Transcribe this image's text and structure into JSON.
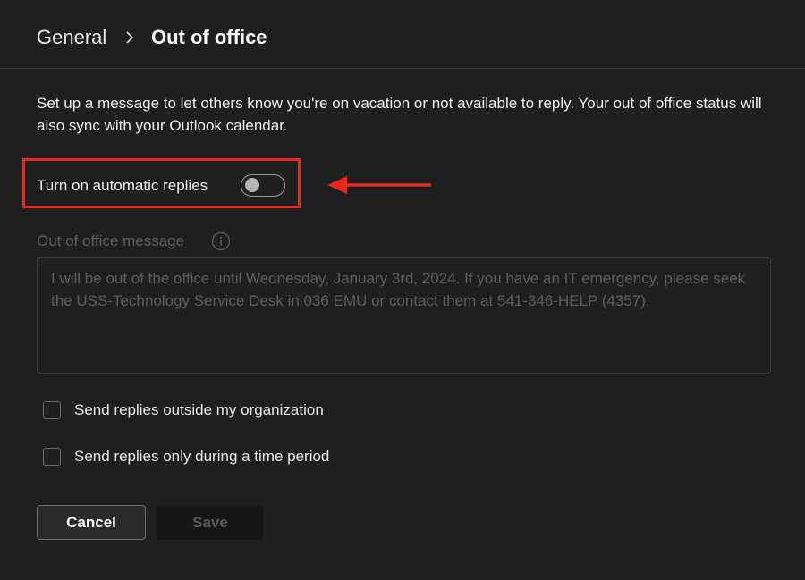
{
  "breadcrumb": {
    "root": "General",
    "current": "Out of office"
  },
  "description": "Set up a message to let others know you're on vacation or not available to reply. Your out of office status will also sync with your Outlook calendar.",
  "automatic_replies": {
    "label": "Turn on automatic replies",
    "enabled": false,
    "highlight_color": "#e8271d"
  },
  "message": {
    "label": "Out of office message",
    "text": "I will be out of the office until Wednesday, January 3rd, 2024. If you have an IT emergency, please seek the USS-Technology Service Desk in 036 EMU or contact them at 541-346-HELP (4357)."
  },
  "options": [
    {
      "label": "Send replies outside my organization",
      "checked": false
    },
    {
      "label": "Send replies only during a time period",
      "checked": false
    }
  ],
  "buttons": {
    "cancel": "Cancel",
    "save": "Save"
  },
  "icons": {
    "breadcrumb_separator": "chevron-right-icon",
    "info": "info-icon",
    "annotation": "red-arrow-icon"
  },
  "colors": {
    "background": "#1f1f1f",
    "annotation": "#e8271d"
  }
}
